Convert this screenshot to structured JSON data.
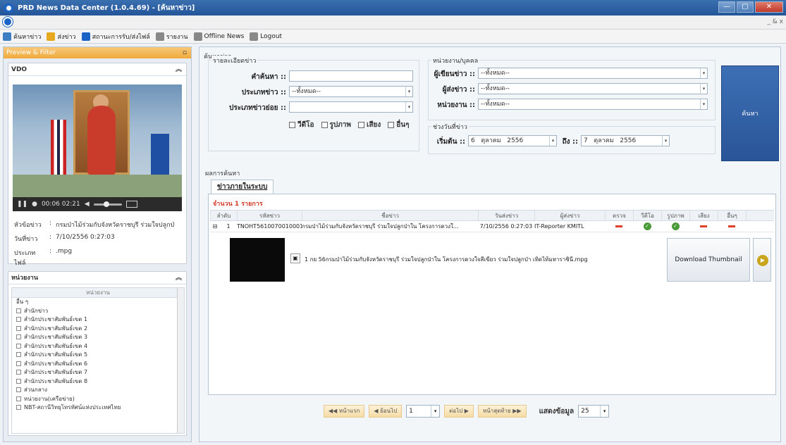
{
  "window": {
    "title": "PRD News Data Center (1.0.4.69) - [ค้นหาข่าว]",
    "controls": [
      "—",
      "▢",
      "✕"
    ]
  },
  "menu": {
    "mdi": "_ & x"
  },
  "toolbar": {
    "items": [
      {
        "label": "ค้นหาข่าว",
        "icon": "search-icon",
        "color": "#3d7fc2"
      },
      {
        "label": "ส่งข่าว",
        "icon": "document-icon",
        "color": "#e6a81e"
      },
      {
        "label": "สถานะการรับ/ส่งไฟล์",
        "icon": "info-icon",
        "color": "#1b63c6"
      },
      {
        "label": "รายงาน",
        "icon": "report-icon",
        "color": "#888888"
      },
      {
        "label": "Offline News",
        "icon": "offline-icon",
        "color": "#888888"
      },
      {
        "label": "Logout",
        "icon": "logout-icon",
        "color": "#888888"
      }
    ]
  },
  "left": {
    "header": "Preview & Filter",
    "vdo": {
      "title": "VDO",
      "time": "00:06 02:21"
    },
    "info": [
      {
        "key": "หัวข้อข่าว",
        "value": "กรมป่าไม้ร่วมกับจังหวัดราชบุรี ร่วมใจปลูกป่"
      },
      {
        "key": "วันที่ข่าว",
        "value": "7/10/2556 0:27:03"
      },
      {
        "key": "ประเภทไฟล์",
        "value": ".mpg"
      }
    ],
    "dept": {
      "title": "หน่วยงาน",
      "list_header": "หน่วยงาน",
      "items": [
        "อื่น ๆ",
        "สำนักข่าว",
        "สำนักประชาสัมพันธ์เขต 1",
        "สำนักประชาสัมพันธ์เขต 2",
        "สำนักประชาสัมพันธ์เขต 3",
        "สำนักประชาสัมพันธ์เขต 4",
        "สำนักประชาสัมพันธ์เขต 5",
        "สำนักประชาสัมพันธ์เขต 6",
        "สำนักประชาสัมพันธ์เขต 7",
        "สำนักประชาสัมพันธ์เขต 8",
        "ส่วนกลาง",
        "หน่วยงาน(เครือข่าย)",
        "NBT-สถานีวิทยุโทรทัศน์แห่งประเทศไทย"
      ]
    }
  },
  "search": {
    "group_title": "ค้นหาข่าว",
    "details": {
      "title": "รายละเอียดข่าว",
      "keyword_label": "คำค้นหา ::",
      "keyword_value": "",
      "type_label": "ประเภทข่าว ::",
      "type_value": "--ทั้งหมด--",
      "subtype_label": "ประเภทข่าวย่อย ::",
      "subtype_value": ""
    },
    "media": [
      "วีดีโอ",
      "รูปภาพ",
      "เสียง",
      "อื่นๆ"
    ],
    "unit": {
      "title": "หน่วยงาน/บุคคล",
      "writer_label": "ผู้เขียนข่าว ::",
      "writer_value": "--ทั้งหมด--",
      "sender_label": "ผู้ส่งข่าว ::",
      "sender_value": "--ทั้งหมด--",
      "dept_label": "หน่วยงาน ::",
      "dept_value": "--ทั้งหมด--"
    },
    "date": {
      "title": "ช่วงวันที่ข่าว",
      "from_label": "เริ่มต้น ::",
      "from_day": "6",
      "from_month": "ตุลาคม",
      "from_year": "2556",
      "to_label": "ถึง ::",
      "to_day": "7",
      "to_month": "ตุลาคม",
      "to_year": "2556"
    },
    "button": "ค้นหา"
  },
  "results": {
    "group_title": "ผลการค้นหา",
    "tab": "ข่าวภายในระบบ",
    "count": "จำนวน 1 รายการ",
    "columns": [
      "ลำดับ",
      "รหัสข่าว",
      "ชื่อข่าว",
      "วันส่งข่าว",
      "ผู้ส่งข่าว",
      "ตรวจ",
      "วีดีโอ",
      "รูปภาพ",
      "เสียง",
      "อื่นๆ"
    ],
    "row": {
      "no": "1",
      "code": "TNOHT5610070010001",
      "title": "กรมป่าไม้ร่วมกับจังหวัดราชบุรี ร่วมใจปลูกป่าใน โครงการดวงใ...",
      "date": "7/10/2556 0:27:03",
      "sender": "IT-Reporter KMITL",
      "checked": false,
      "video": true,
      "image": true,
      "audio": false,
      "other": false
    },
    "file": "1 กย 56กรมป่าไม้ร่วมกับจังหวัดราชบุรี ร่วมใจปลูกป่าใน โครงการดวงใจสีเขียว ร่วมใจปลูกป่า เทิดไท้มหาราชินี.mpg",
    "download_label": "Download Thumbnail"
  },
  "pager": {
    "first": "หน้าแรก",
    "prev": "ย้อนไป",
    "page": "1",
    "next": "ต่อไป",
    "last": "หน้าสุดท้าย",
    "size_label": "แสดงข้อมูล",
    "size": "25"
  }
}
